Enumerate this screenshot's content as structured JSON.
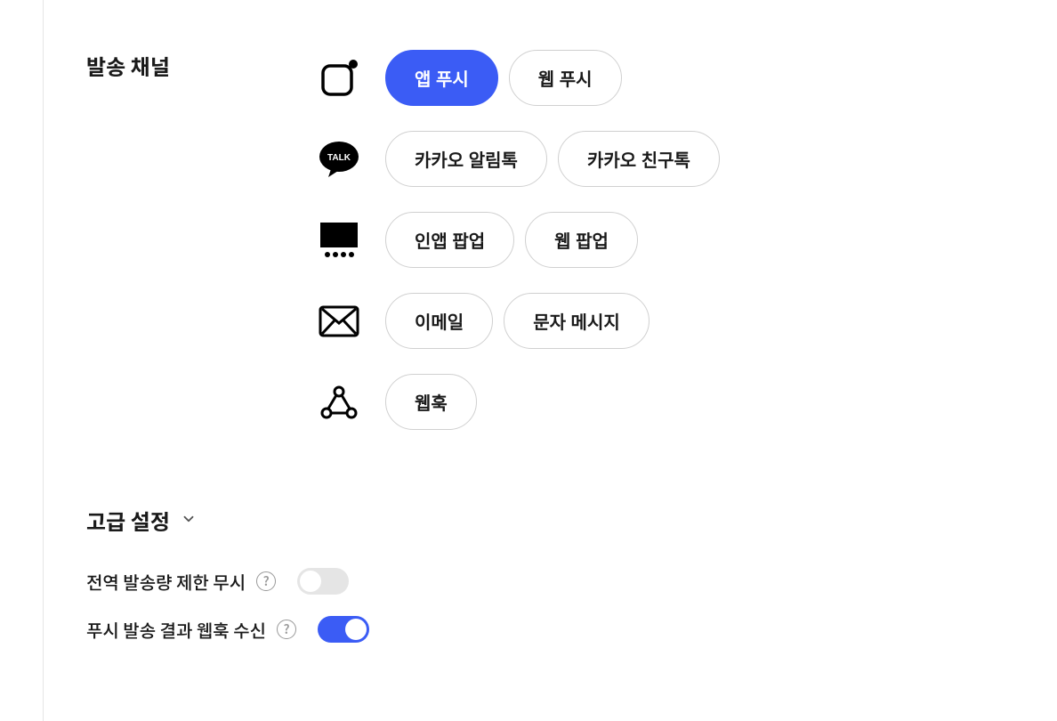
{
  "section": {
    "title": "발송 채널"
  },
  "channels": {
    "rows": [
      {
        "icon": "push-icon",
        "options": [
          {
            "label": "앱 푸시",
            "selected": true
          },
          {
            "label": "웹 푸시",
            "selected": false
          }
        ]
      },
      {
        "icon": "talk-icon",
        "options": [
          {
            "label": "카카오 알림톡",
            "selected": false
          },
          {
            "label": "카카오 친구톡",
            "selected": false
          }
        ]
      },
      {
        "icon": "popup-icon",
        "options": [
          {
            "label": "인앱 팝업",
            "selected": false
          },
          {
            "label": "웹 팝업",
            "selected": false
          }
        ]
      },
      {
        "icon": "mail-icon",
        "options": [
          {
            "label": "이메일",
            "selected": false
          },
          {
            "label": "문자 메시지",
            "selected": false
          }
        ]
      },
      {
        "icon": "webhook-icon",
        "options": [
          {
            "label": "웹훅",
            "selected": false
          }
        ]
      }
    ]
  },
  "advanced": {
    "title": "고급 설정",
    "settings": [
      {
        "label": "전역 발송량 제한 무시",
        "value": false
      },
      {
        "label": "푸시 발송 결과 웹훅 수신",
        "value": true
      }
    ]
  }
}
